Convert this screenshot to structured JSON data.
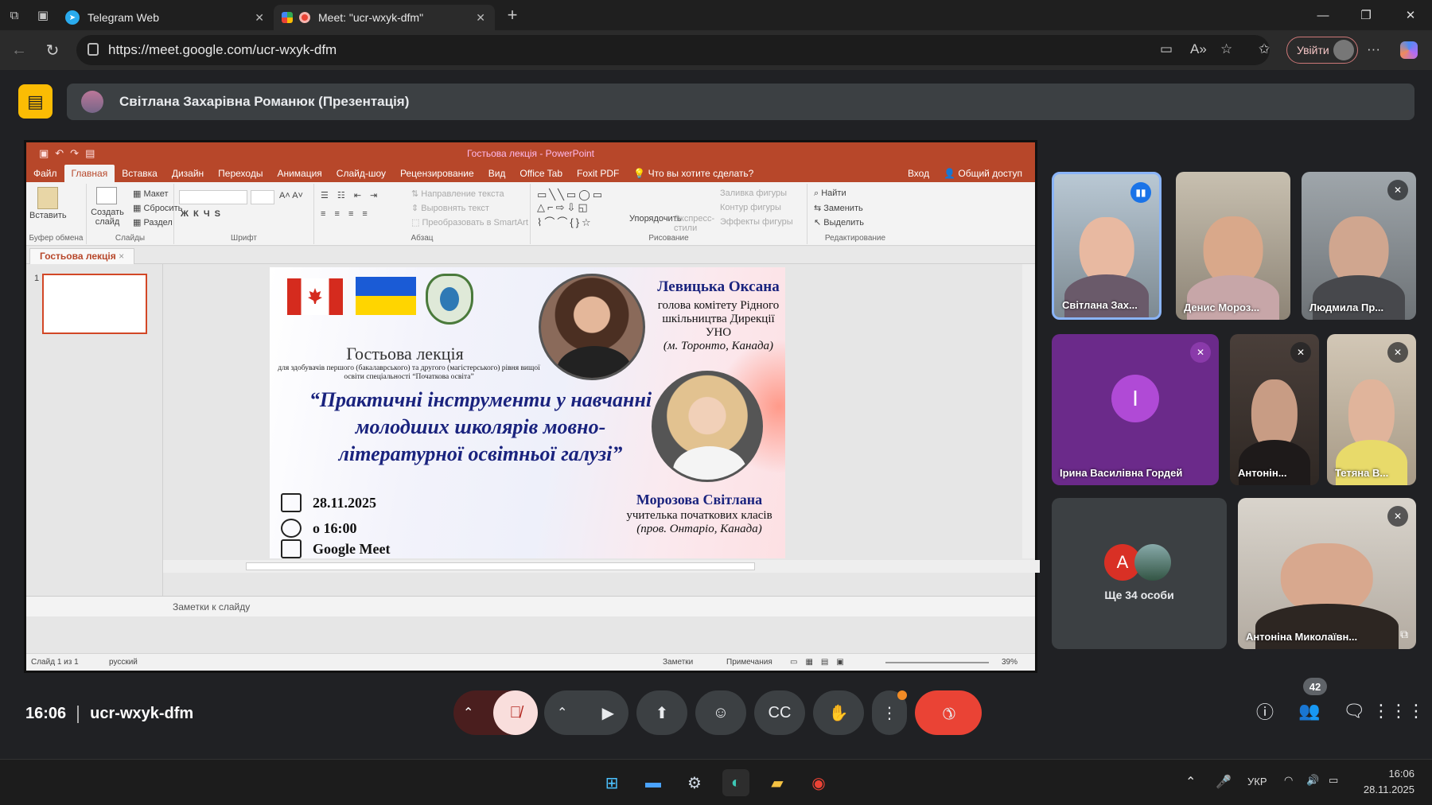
{
  "browser": {
    "tabs": [
      {
        "title": "Telegram Web",
        "icon": "telegram-icon"
      },
      {
        "title": "Meet: \"ucr-wxyk-dfm\"",
        "icon": "meet-icon"
      }
    ],
    "url": "https://meet.google.com/ucr-wxyk-dfm",
    "signin_label": "Увійти"
  },
  "meet": {
    "presenter_banner": "Світлана Захарівна Романюк (Презентація)",
    "time": "16:06",
    "meeting_code": "ucr-wxyk-dfm",
    "participant_count": "42",
    "participants": [
      {
        "name": "Світлана Зах...",
        "state": "speaking"
      },
      {
        "name": "Денис Мороз...",
        "state": ""
      },
      {
        "name": "Людмила Пр...",
        "state": "muted"
      },
      {
        "name": "Ірина Василівна Гордей",
        "initial": "І",
        "state": "muted"
      },
      {
        "name": "Антонін...",
        "state": "muted"
      },
      {
        "name": "Тетяна В...",
        "state": "muted"
      },
      {
        "name": "Антоніна Миколаївн...",
        "state": "muted"
      }
    ],
    "more_people": {
      "label": "Ще 34 особи",
      "initial": "A"
    },
    "accent": "#ea4335"
  },
  "ppt": {
    "window_title": "Гостьова лекція - PowerPoint",
    "menu": [
      "Файл",
      "Главная",
      "Вставка",
      "Дизайн",
      "Переходы",
      "Анимация",
      "Слайд-шоу",
      "Рецензирование",
      "Вид",
      "Office Tab",
      "Foxit PDF"
    ],
    "tell_me": "Что вы хотите сделать?",
    "signin": "Вход",
    "share": "Общий доступ",
    "ribbon": {
      "paste": "Вставить",
      "new_slide": "Создать слайд",
      "layout": "Макет",
      "reset": "Сбросить",
      "section": "Раздел",
      "text_dir": "Направление текста",
      "align_text": "Выровнять текст",
      "smartart": "Преобразовать в SmartArt",
      "arrange": "Упорядочить",
      "quick_styles": "Экспресс-стили",
      "fill": "Заливка фигуры",
      "outline": "Контур фигуры",
      "effects": "Эффекты фигуры",
      "find": "Найти",
      "replace": "Заменить",
      "select": "Выделить",
      "g_clipboard": "Буфер обмена",
      "g_slides": "Слайды",
      "g_font": "Шрифт",
      "g_paragraph": "Абзац",
      "g_drawing": "Рисование",
      "g_editing": "Редактирование"
    },
    "doc_tab": "Гостьова лекція",
    "thumb_num": "1",
    "notes_placeholder": "Заметки к слайду",
    "status": {
      "slide": "Слайд 1 из 1",
      "lang": "русский",
      "notes": "Заметки",
      "comments": "Примечания",
      "zoom": "39%"
    }
  },
  "slide": {
    "title": "Гостьова лекція",
    "subtitle": "для здобувачів першого (бакалаврського) та другого (магістерського) рівня вищої освіти спеціальності “Початкова освіта”",
    "topic": "“Практичні інструменти у навчанні молодших школярів мовно-літературної освітньої галузі”",
    "date": "28.11.2025",
    "time": "о 16:00",
    "platform": "Google Meet",
    "speaker1_name": "Левицька Оксана",
    "speaker1_role": "голова комітету Рідного шкільництва Дирекції УНО",
    "speaker1_place": "(м. Торонто, Канада)",
    "speaker2_name": "Морозова Світлана",
    "speaker2_role": "учителька початкових класів",
    "speaker2_place": "(пров. Онтаріо, Канада)"
  },
  "taskbar": {
    "lang": "УКР",
    "time": "16:06",
    "date": "28.11.2025"
  }
}
